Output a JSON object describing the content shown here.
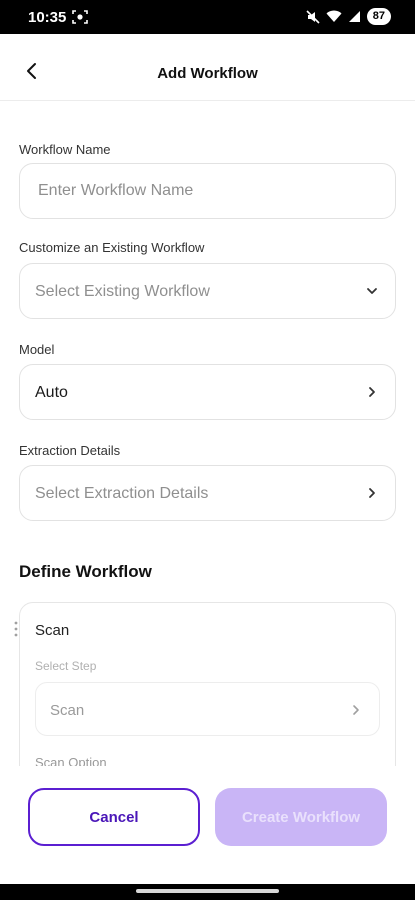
{
  "status_bar": {
    "time": "10:35",
    "battery": "87",
    "icons": [
      "screenshot-icon",
      "mute-icon",
      "wifi-icon",
      "signal-icon",
      "battery-icon"
    ]
  },
  "header": {
    "title": "Add Workflow",
    "back_icon": "chevron-left-icon"
  },
  "form": {
    "workflow_name": {
      "label": "Workflow Name",
      "placeholder": "Enter Workflow Name",
      "value": ""
    },
    "existing_workflow": {
      "label": "Customize an Existing Workflow",
      "placeholder": "Select Existing Workflow",
      "icon": "chevron-down-icon"
    },
    "model": {
      "label": "Model",
      "value": "Auto",
      "icon": "chevron-right-icon"
    },
    "extraction": {
      "label": "Extraction Details",
      "placeholder": "Select Extraction Details",
      "icon": "chevron-right-icon"
    }
  },
  "define_workflow": {
    "title": "Define Workflow",
    "step": {
      "title": "Scan",
      "select_step_label": "Select Step",
      "select_step_value": "Scan",
      "option_label": "Scan Option"
    }
  },
  "actions": {
    "cancel_label": "Cancel",
    "create_label": "Create Workflow"
  },
  "colors": {
    "accent": "#5b1fd1",
    "accent_disabled": "#c9b5f6",
    "border": "#e2e2e2"
  }
}
